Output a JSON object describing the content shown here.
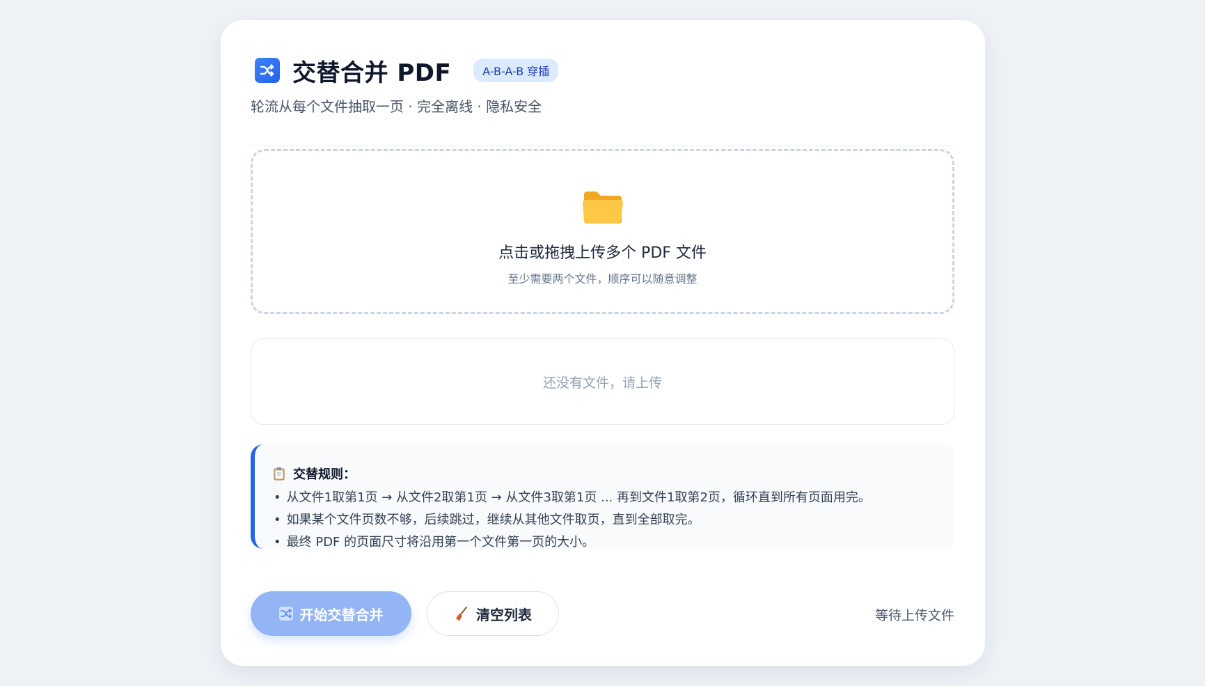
{
  "header": {
    "icon": "shuffle-icon",
    "title": "交替合并 PDF",
    "badge": "A-B-A-B 穿插",
    "subtitle": "轮流从每个文件抽取一页 · 完全离线 · 隐私安全"
  },
  "dropzone": {
    "icon": "folder-icon",
    "title": "点击或拖拽上传多个 PDF 文件",
    "hint": "至少需要两个文件，顺序可以随意调整"
  },
  "file_list": {
    "empty_text": "还没有文件，请上传"
  },
  "rules": {
    "icon": "clipboard-icon",
    "title": "交替规则：",
    "bullet": "•",
    "items": [
      "从文件1取第1页 → 从文件2取第1页 → 从文件3取第1页 ... 再到文件1取第2页，循环直到所有页面用完。",
      "如果某个文件页数不够，后续跳过，继续从其他文件取页，直到全部取完。",
      "最终 PDF 的页面尺寸将沿用第一个文件第一页的大小。"
    ]
  },
  "actions": {
    "start_label": "开始交替合并",
    "start_icon": "shuffle-icon",
    "start_disabled": true,
    "clear_label": "清空列表",
    "clear_icon": "broom-icon",
    "status": "等待上传文件"
  },
  "colors": {
    "accent": "#2563eb",
    "badge_bg": "#dbeafe",
    "folder": "#f5b52e",
    "page_bg": "#eef2f7"
  }
}
